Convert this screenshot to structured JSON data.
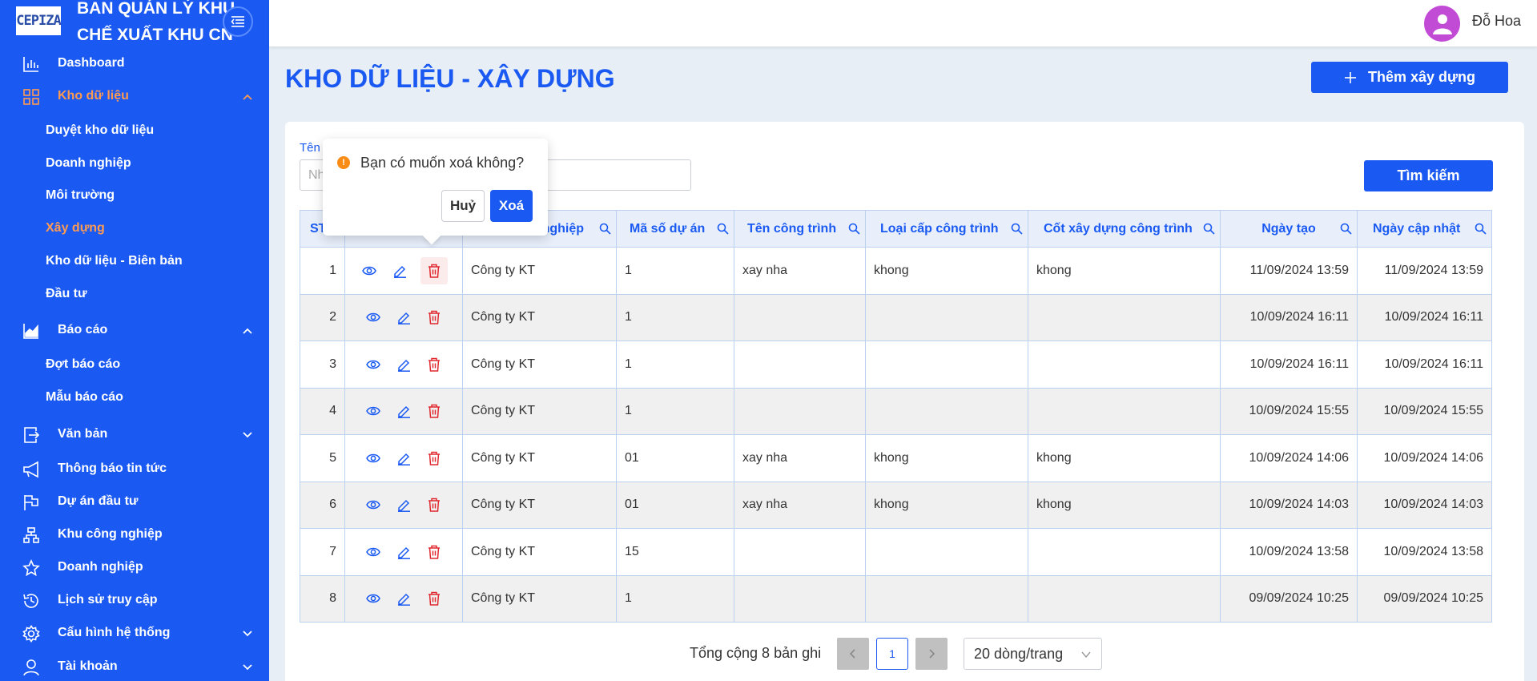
{
  "app": {
    "brand_logo": "CEPIZA",
    "brand_title_line1": "BAN QUẢN LÝ KHU",
    "brand_title_line2": "CHẾ XUẤT KHU CN"
  },
  "sidebar": {
    "items": [
      {
        "label": "Dashboard",
        "icon": "bar-chart-icon"
      },
      {
        "label": "Kho dữ liệu",
        "icon": "grid-icon",
        "active": true,
        "expanded": true
      },
      {
        "label": "Báo cáo",
        "icon": "area-chart-icon",
        "expanded": true
      },
      {
        "label": "Văn bản",
        "icon": "document-export-icon"
      },
      {
        "label": "Thông báo tin tức",
        "icon": "megaphone-icon"
      },
      {
        "label": "Dự án đầu tư",
        "icon": "flag-icon"
      },
      {
        "label": "Khu công nghiệp",
        "icon": "network-icon"
      },
      {
        "label": "Doanh nghiệp",
        "icon": "star-icon"
      },
      {
        "label": "Lịch sử truy cập",
        "icon": "history-icon"
      },
      {
        "label": "Cấu hình hệ thống",
        "icon": "gear-icon"
      },
      {
        "label": "Tài khoản",
        "icon": "user-icon"
      }
    ],
    "kho_sub": [
      "Duyệt kho dữ liệu",
      "Doanh nghiệp",
      "Môi trường",
      "Xây dựng",
      "Kho dữ liệu - Biên bản",
      "Đầu tư"
    ],
    "bao_cao_sub": [
      "Đợt báo cáo",
      "Mẫu báo cáo"
    ]
  },
  "header": {
    "user_name": "Đỗ Hoa"
  },
  "page": {
    "title": "KHO DỮ LIỆU - XÂY DỰNG",
    "add_button": "Thêm xây dựng",
    "filter_label": "Tên",
    "filter_placeholder": "Nh",
    "search_button": "Tìm kiếm"
  },
  "table": {
    "columns": [
      "ST",
      "",
      "nghiệp",
      "Mã số dự án",
      "Tên công trình",
      "Loại cấp công trình",
      "Cốt xây dựng công trình",
      "Ngày tạo",
      "Ngày cập nhật"
    ],
    "rows": [
      {
        "stt": "1",
        "dn": "Công ty KT",
        "ma": "1",
        "ten": "xay nha",
        "loai": "khong",
        "cot": "khong",
        "tao": "11/09/2024 13:59",
        "cn": "11/09/2024 13:59"
      },
      {
        "stt": "2",
        "dn": "Công ty KT",
        "ma": "1",
        "ten": "",
        "loai": "",
        "cot": "",
        "tao": "10/09/2024 16:11",
        "cn": "10/09/2024 16:11"
      },
      {
        "stt": "3",
        "dn": "Công ty KT",
        "ma": "1",
        "ten": "",
        "loai": "",
        "cot": "",
        "tao": "10/09/2024 16:11",
        "cn": "10/09/2024 16:11"
      },
      {
        "stt": "4",
        "dn": "Công ty KT",
        "ma": "1",
        "ten": "",
        "loai": "",
        "cot": "",
        "tao": "10/09/2024 15:55",
        "cn": "10/09/2024 15:55"
      },
      {
        "stt": "5",
        "dn": "Công ty KT",
        "ma": "01",
        "ten": "xay nha",
        "loai": "khong",
        "cot": "khong",
        "tao": "10/09/2024 14:06",
        "cn": "10/09/2024 14:06"
      },
      {
        "stt": "6",
        "dn": "Công ty KT",
        "ma": "01",
        "ten": "xay nha",
        "loai": "khong",
        "cot": "khong",
        "tao": "10/09/2024 14:03",
        "cn": "10/09/2024 14:03"
      },
      {
        "stt": "7",
        "dn": "Công ty KT",
        "ma": "15",
        "ten": "",
        "loai": "",
        "cot": "",
        "tao": "10/09/2024 13:58",
        "cn": "10/09/2024 13:58"
      },
      {
        "stt": "8",
        "dn": "Công ty KT",
        "ma": "1",
        "ten": "",
        "loai": "",
        "cot": "",
        "tao": "09/09/2024 10:25",
        "cn": "09/09/2024 10:25"
      }
    ]
  },
  "pagination": {
    "total_text": "Tổng cộng 8 bản ghi",
    "current_page": "1",
    "prev": "<",
    "next": ">",
    "page_size": "20 dòng/trang"
  },
  "popconfirm": {
    "icon": "!",
    "message": "Bạn có muốn xoá không?",
    "cancel": "Huỷ",
    "ok": "Xoá"
  },
  "colors": {
    "primary": "#1a5af2",
    "active_orange": "#ff9a52",
    "danger": "#e0282e",
    "warning": "#fa8c16"
  }
}
